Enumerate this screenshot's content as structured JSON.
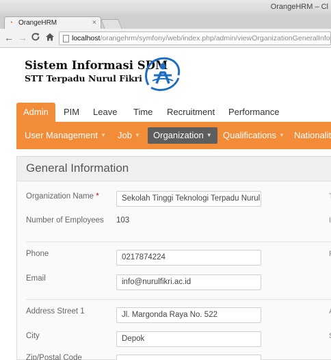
{
  "browser": {
    "window_title": "OrangeHRM – Cl",
    "tab_title": "OrangeHRM",
    "tab_close": "×",
    "url_host": "localhost",
    "url_path": "/orangehrm/symfony/web/index.php/admin/viewOrganizationGeneralInforma",
    "icons": [
      "back-arrow-icon",
      "forward-arrow-icon",
      "reload-icon",
      "home-icon",
      "page-icon"
    ]
  },
  "header": {
    "title_line1": "Sistem Informasi SDM",
    "title_line2": "STT Terpadu Nurul Fikri",
    "logo_colors": {
      "ring": "#1c6fc0",
      "figure": "#1c6fc0"
    }
  },
  "main_menu": [
    "Admin",
    "PIM",
    "Leave",
    "Time",
    "Recruitment",
    "Performance"
  ],
  "sub_menu": [
    {
      "label": "User Management",
      "arrow": "▼"
    },
    {
      "label": "Job",
      "arrow": "▼"
    },
    {
      "label": "Organization",
      "arrow": "▼"
    },
    {
      "label": "Qualifications",
      "arrow": "▼"
    },
    {
      "label": "Nationalit",
      "arrow": ""
    }
  ],
  "colors": {
    "accent": "#f28c38",
    "active_submenu": "#5e5e5e"
  },
  "form": {
    "title": "General Information",
    "org_name_label": "Organization Name",
    "required_mark": "*",
    "org_name_value": "Sekolah Tinggi Teknologi Terpadu Nurul",
    "employees_label": "Number of Employees",
    "employees_value": "103",
    "phone_label": "Phone",
    "phone_value": "0217874224",
    "email_label": "Email",
    "email_value": "info@nurulfikri.ac.id",
    "address1_label": "Address Street 1",
    "address1_value": "Jl. Margonda Raya No. 522",
    "city_label": "City",
    "city_value": "Depok",
    "zip_label": "Zip/Postal Code",
    "edge_letters": [
      "T",
      "I",
      "F",
      "A",
      "S"
    ]
  }
}
